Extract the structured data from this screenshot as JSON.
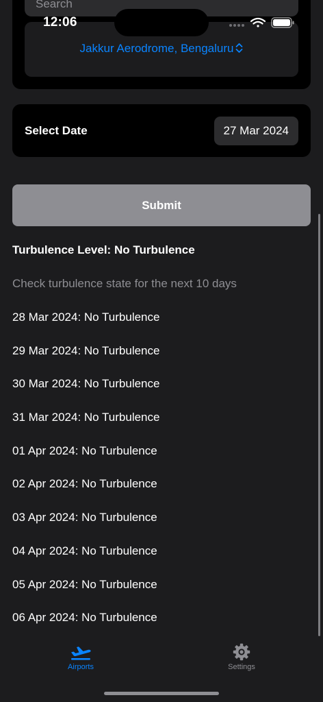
{
  "status_bar": {
    "time": "12:06"
  },
  "search": {
    "placeholder": "Search"
  },
  "airport": {
    "selected": "Jakkur Aerodrome, Bengaluru"
  },
  "date_selector": {
    "label": "Select Date",
    "value": "27 Mar 2024"
  },
  "submit": {
    "label": "Submit"
  },
  "result": {
    "turbulence_level": "Turbulence Level: No Turbulence",
    "subtitle": "Check turbulence state for the next 10 days",
    "forecast": [
      "28 Mar 2024: No Turbulence",
      "29 Mar 2024: No Turbulence",
      "30 Mar 2024: No Turbulence",
      "31 Mar 2024: No Turbulence",
      "01 Apr 2024: No Turbulence",
      "02 Apr 2024: No Turbulence",
      "03 Apr 2024: No Turbulence",
      "04 Apr 2024: No Turbulence",
      "05 Apr 2024: No Turbulence",
      "06 Apr 2024: No Turbulence"
    ]
  },
  "tabbar": {
    "items": [
      {
        "label": "Airports",
        "icon": "airplane-departure-icon",
        "active": true
      },
      {
        "label": "Settings",
        "icon": "gear-icon",
        "active": false
      }
    ]
  },
  "colors": {
    "accent": "#0a84ff",
    "background": "#1c1c1e",
    "card": "#000000",
    "secondary_text": "#8e8e93",
    "submit_disabled": "#8e8e93"
  }
}
